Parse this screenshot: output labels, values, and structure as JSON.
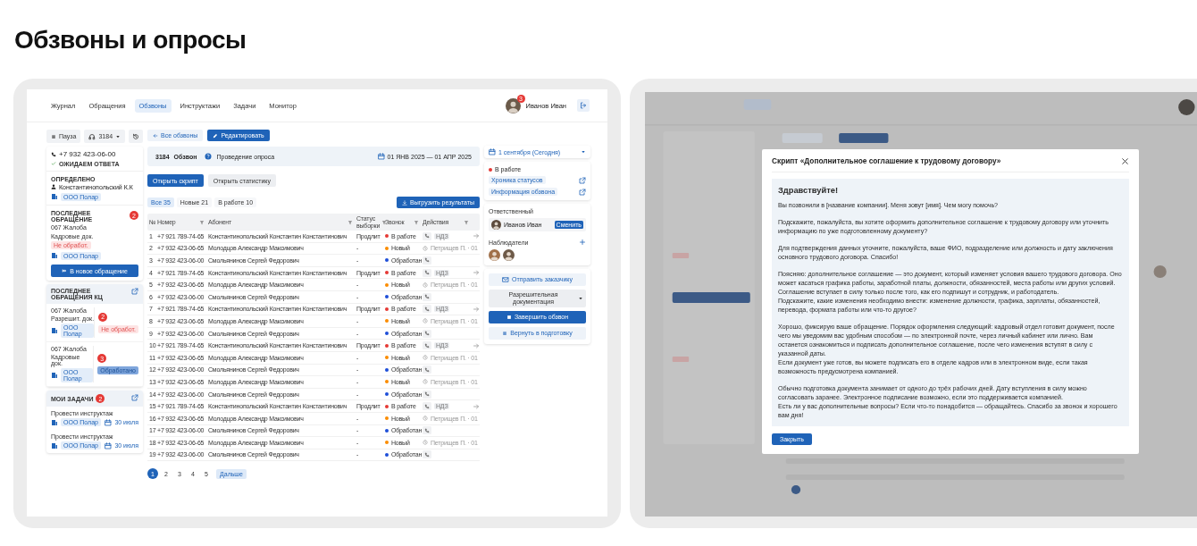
{
  "page_title": "Обзвоны и опросы",
  "nav": {
    "items": [
      {
        "label": "Журнал",
        "selected": false
      },
      {
        "label": "Обращения",
        "selected": false
      },
      {
        "label": "Обзвоны",
        "selected": true
      },
      {
        "label": "Инструктажи",
        "selected": false
      },
      {
        "label": "Задачи",
        "selected": false
      },
      {
        "label": "Монитор",
        "selected": false
      }
    ],
    "user": {
      "name": "Иванов Иван",
      "badge": "3"
    }
  },
  "sidebar": {
    "pause": "Пауза",
    "line": "3184",
    "call": {
      "phone": "+7 932 423-06-00",
      "status": "ОЖИДАЕМ ОТВЕТА"
    },
    "identified": {
      "heading": "ОПРЕДЕЛЕНО",
      "person": "Константинопольский К.К",
      "org": "ООО Полар"
    },
    "last_request": {
      "heading": "ПОСЛЕДНЕЕ ОБРАЩЕНИЕ",
      "count": "2",
      "title": "067 Жалоба",
      "category": "Кадровые док.",
      "status": "Не обработ.",
      "processed": false,
      "org": "ООО Полар",
      "button": "В новое обращение"
    },
    "kc": {
      "heading": "ПОСЛЕДНЕЕ ОБРАЩЕНИЯ КЦ",
      "items": [
        {
          "title": "067 Жалоба",
          "category": "Разрешит. док.",
          "count": "2",
          "org": "ООО Полар",
          "status": "Не обработ.",
          "processed": false
        },
        {
          "title": "067 Жалоба",
          "category": "Кадровые док.",
          "count": "3",
          "org": "ООО Полар",
          "status": "Обработано",
          "processed": true
        }
      ]
    },
    "tasks": {
      "heading": "МОИ ЗАДАЧИ",
      "count": "2",
      "items": [
        {
          "title": "Провести инструктаж",
          "org": "ООО Полар",
          "date": "30 июля"
        },
        {
          "title": "Провести инструктаж",
          "org": "ООО Полар",
          "date": "30 июля"
        }
      ]
    }
  },
  "main": {
    "back": "Все обзвоны",
    "edit": "Редактировать",
    "campaign": {
      "id": "3184",
      "type": "Обзвон",
      "stage": "Проведение опроса",
      "period": "01 ЯНВ 2025 — 01 АПР 2025"
    },
    "open_script": "Открыть скрипт",
    "open_stats": "Открыть статистику",
    "filters": [
      {
        "label": "Все",
        "count": "35",
        "selected": true
      },
      {
        "label": "Новые",
        "count": "21",
        "selected": false
      },
      {
        "label": "В работе",
        "count": "10",
        "selected": false
      }
    ],
    "export": "Выгрузить результаты",
    "table": {
      "columns": [
        {
          "label": "№",
          "filter": false
        },
        {
          "label": "Номер",
          "filter": true
        },
        {
          "label": "Абонент",
          "filter": true
        },
        {
          "label": "Статус выборки",
          "filter": true
        },
        {
          "label": "Звонок",
          "filter": true
        },
        {
          "label": "Действия",
          "filter": true
        }
      ],
      "rows": [
        {
          "n": "1",
          "phone": "+7 921 789-74-65",
          "name": "Константинопольский Константин Константинович",
          "sample": "Продлит",
          "call": "В работе",
          "color": "#e53935",
          "kind": "phone_tag",
          "tag": "НДЗ",
          "arrow": true
        },
        {
          "n": "2",
          "phone": "+7 932 423-06-65",
          "name": "Молодцов Александр Максимович",
          "sample": "-",
          "call": "Новый",
          "color": "#fb8c00",
          "kind": "assignee",
          "assignee": "Петрищев П. · 01",
          "arrow": false
        },
        {
          "n": "3",
          "phone": "+7 932 423-06-00",
          "name": "Смольянинов Сергей Федорович",
          "sample": "-",
          "call": "Обработан",
          "color": "#1e4fd8",
          "kind": "phone",
          "arrow": false
        },
        {
          "n": "4",
          "phone": "+7 921 789-74-65",
          "name": "Константинопольский Константин Константинович",
          "sample": "Продлит",
          "call": "В работе",
          "color": "#e53935",
          "kind": "phone_tag",
          "tag": "НДЗ",
          "arrow": true
        },
        {
          "n": "5",
          "phone": "+7 932 423-06-65",
          "name": "Молодцов Александр Максимович",
          "sample": "-",
          "call": "Новый",
          "color": "#fb8c00",
          "kind": "assignee",
          "assignee": "Петрищев П. · 01",
          "arrow": false
        },
        {
          "n": "6",
          "phone": "+7 932 423-06-00",
          "name": "Смольянинов Сергей Федорович",
          "sample": "-",
          "call": "Обработан",
          "color": "#1e4fd8",
          "kind": "phone",
          "arrow": false
        },
        {
          "n": "7",
          "phone": "+7 921 789-74-65",
          "name": "Константинопольский Константин Константинович",
          "sample": "Продлит",
          "call": "В работе",
          "color": "#e53935",
          "kind": "phone_tag",
          "tag": "НДЗ",
          "arrow": true
        },
        {
          "n": "8",
          "phone": "+7 932 423-06-65",
          "name": "Молодцов Александр Максимович",
          "sample": "-",
          "call": "Новый",
          "color": "#fb8c00",
          "kind": "assignee",
          "assignee": "Петрищев П. · 01",
          "arrow": false
        },
        {
          "n": "9",
          "phone": "+7 932 423-06-00",
          "name": "Смольянинов Сергей Федорович",
          "sample": "-",
          "call": "Обработан",
          "color": "#1e4fd8",
          "kind": "phone",
          "arrow": false
        },
        {
          "n": "10",
          "phone": "+7 921 789-74-65",
          "name": "Константинопольский Константин Константинович",
          "sample": "Продлит",
          "call": "В работе",
          "color": "#e53935",
          "kind": "phone_tag",
          "tag": "НДЗ",
          "arrow": true
        },
        {
          "n": "11",
          "phone": "+7 932 423-06-65",
          "name": "Молодцов Александр Максимович",
          "sample": "-",
          "call": "Новый",
          "color": "#fb8c00",
          "kind": "assignee",
          "assignee": "Петрищев П. · 01",
          "arrow": false
        },
        {
          "n": "12",
          "phone": "+7 932 423-06-00",
          "name": "Смольянинов Сергей Федорович",
          "sample": "-",
          "call": "Обработан",
          "color": "#1e4fd8",
          "kind": "phone",
          "arrow": false
        },
        {
          "n": "13",
          "phone": "+7 932 423-06-65",
          "name": "Молодцов Александр Максимович",
          "sample": "-",
          "call": "Новый",
          "color": "#fb8c00",
          "kind": "assignee",
          "assignee": "Петрищев П. · 01",
          "arrow": false
        },
        {
          "n": "14",
          "phone": "+7 932 423-06-00",
          "name": "Смольянинов Сергей Федорович",
          "sample": "-",
          "call": "Обработан",
          "color": "#1e4fd8",
          "kind": "phone",
          "arrow": false
        },
        {
          "n": "15",
          "phone": "+7 921 789-74-65",
          "name": "Константинопольский Константин Константинович",
          "sample": "Продлит",
          "call": "В работе",
          "color": "#e53935",
          "kind": "phone_tag",
          "tag": "НДЗ",
          "arrow": true
        },
        {
          "n": "16",
          "phone": "+7 932 423-06-65",
          "name": "Молодцов Александр Максимович",
          "sample": "-",
          "call": "Новый",
          "color": "#fb8c00",
          "kind": "assignee",
          "assignee": "Петрищев П. · 01",
          "arrow": false
        },
        {
          "n": "17",
          "phone": "+7 932 423-06-00",
          "name": "Смольянинов Сергей Федорович",
          "sample": "-",
          "call": "Обработан",
          "color": "#1e4fd8",
          "kind": "phone",
          "arrow": false
        },
        {
          "n": "18",
          "phone": "+7 932 423-06-65",
          "name": "Молодцов Александр Максимович",
          "sample": "-",
          "call": "Новый",
          "color": "#fb8c00",
          "kind": "assignee",
          "assignee": "Петрищев П. · 01",
          "arrow": false
        },
        {
          "n": "19",
          "phone": "+7 932 423-06-00",
          "name": "Смольянинов Сергей Федорович",
          "sample": "-",
          "call": "Обработан",
          "color": "#1e4fd8",
          "kind": "phone",
          "arrow": false
        }
      ]
    },
    "pages": [
      {
        "label": "1",
        "selected": true
      },
      {
        "label": "2",
        "selected": false
      },
      {
        "label": "3",
        "selected": false
      },
      {
        "label": "4",
        "selected": false
      },
      {
        "label": "5",
        "selected": false
      }
    ],
    "next": "Дальше"
  },
  "panel": {
    "date": "1 сентября (Сегодня)",
    "state": {
      "label": "В работе",
      "color": "#e53935"
    },
    "links": [
      "Хроника статусов",
      "Информация обзвона"
    ],
    "responsible": {
      "heading": "Ответственный",
      "name": "Иванов Иван",
      "change": "Сменить"
    },
    "observers": {
      "heading": "Наблюдатели",
      "people": [
        {
          "kind": "photo"
        },
        {
          "kind": "photo"
        }
      ]
    },
    "send": "Отправить заказчику",
    "docs": "Разрешительная документация",
    "finish": "Завершить обзвон",
    "back_to_prep": "Вернуть в подготовку"
  },
  "modal": {
    "title": "Скрипт «Дополнительное соглашение к трудовому договору»",
    "greeting": "Здравствуйте!",
    "paragraphs": [
      [
        "Вы позвонили в [название компании]. Меня зовут [имя]. Чем могу помочь?"
      ],
      [
        "Подскажите, пожалуйста, вы хотите оформить дополнительное соглашение к трудовому договору или уточнить информацию по уже подготовленному документу?"
      ],
      [
        "Для подтверждения данных уточните, пожалуйста, ваше ФИО, подразделение или должность и дату заключения основного трудового договора. Спасибо!"
      ],
      [
        "Поясняю: дополнительное соглашение — это документ, который изменяет условия вашего трудового договора. Оно может касаться графика работы, заработной платы, должности, обязанностей, места работы или других условий. Соглашение вступает в силу только после того, как его подпишут и сотрудник, и работодатель.",
        "Подскажите, какие изменения необходимо внести: изменение должности, графика, зарплаты, обязанностей, перевода, формата работы или что-то другое?"
      ],
      [
        "Хорошо, фиксирую ваше обращение. Порядок оформления следующий: кадровый отдел готовит документ, после чего мы уведомим вас удобным способом — по электронной почте, через личный кабинет или лично. Вам останется ознакомиться и подписать дополнительное соглашение, после чего изменения вступят в силу с указанной даты.",
        "Если документ уже готов, вы можете подписать его в отделе кадров или в электронном виде, если такая возможность предусмотрена компанией."
      ],
      [
        "Обычно подготовка документа занимает от одного до трёх рабочих дней. Дату вступления в силу можно согласовать заранее. Электронное подписание возможно, если это поддерживается компанией.",
        "Есть ли у вас дополнительные вопросы? Если что-то понадобится — обращайтесь. Спасибо за звонок и хорошего вам дня!"
      ]
    ],
    "close": "Закрыть"
  }
}
